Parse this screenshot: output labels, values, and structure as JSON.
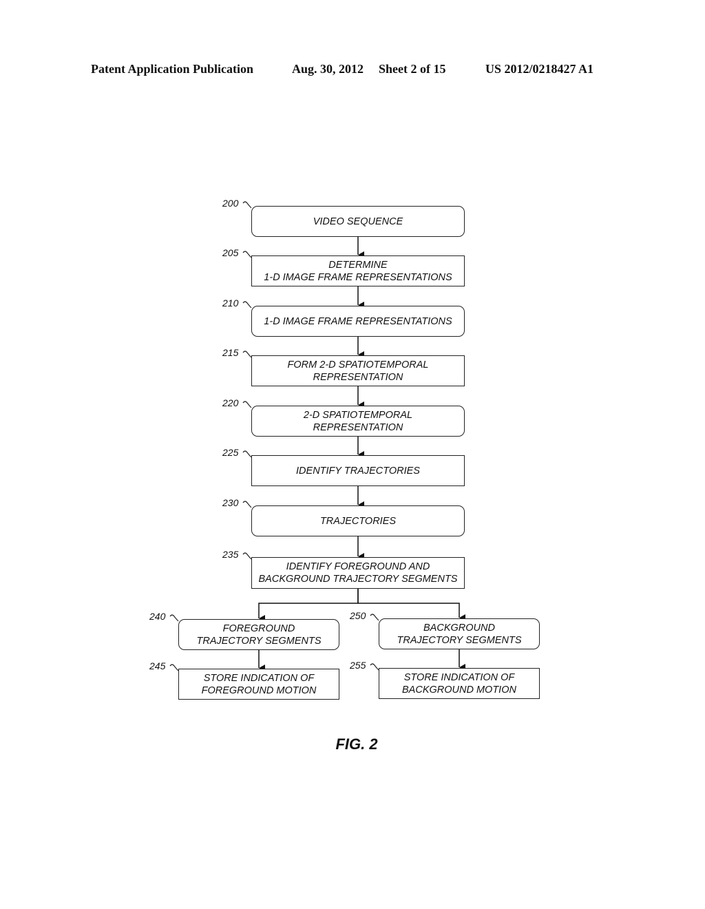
{
  "header": {
    "publication": "Patent Application Publication",
    "date": "Aug. 30, 2012",
    "sheet": "Sheet 2 of 15",
    "number": "US 2012/0218427 A1"
  },
  "nodes": [
    {
      "ref": "200",
      "shape": "rounded",
      "lines": [
        "VIDEO SEQUENCE"
      ]
    },
    {
      "ref": "205",
      "shape": "rect",
      "lines": [
        "DETERMINE",
        "1-D IMAGE FRAME REPRESENTATIONS"
      ]
    },
    {
      "ref": "210",
      "shape": "rounded",
      "lines": [
        "1-D IMAGE FRAME REPRESENTATIONS"
      ]
    },
    {
      "ref": "215",
      "shape": "rect",
      "lines": [
        "FORM 2-D SPATIOTEMPORAL",
        "REPRESENTATION"
      ]
    },
    {
      "ref": "220",
      "shape": "rounded",
      "lines": [
        "2-D SPATIOTEMPORAL",
        "REPRESENTATION"
      ]
    },
    {
      "ref": "225",
      "shape": "rect",
      "lines": [
        "IDENTIFY TRAJECTORIES"
      ]
    },
    {
      "ref": "230",
      "shape": "rounded",
      "lines": [
        "TRAJECTORIES"
      ]
    },
    {
      "ref": "235",
      "shape": "rect",
      "lines": [
        "IDENTIFY FOREGROUND AND",
        "BACKGROUND TRAJECTORY SEGMENTS"
      ]
    },
    {
      "ref": "240",
      "shape": "rounded",
      "lines": [
        "FOREGROUND",
        "TRAJECTORY SEGMENTS"
      ]
    },
    {
      "ref": "245",
      "shape": "rect",
      "lines": [
        "STORE INDICATION OF",
        "FOREGROUND MOTION"
      ]
    },
    {
      "ref": "250",
      "shape": "rounded",
      "lines": [
        "BACKGROUND",
        "TRAJECTORY SEGMENTS"
      ]
    },
    {
      "ref": "255",
      "shape": "rect",
      "lines": [
        "STORE INDICATION OF",
        "BACKGROUND MOTION"
      ]
    }
  ],
  "edges": [
    [
      "200",
      "205"
    ],
    [
      "205",
      "210"
    ],
    [
      "210",
      "215"
    ],
    [
      "215",
      "220"
    ],
    [
      "220",
      "225"
    ],
    [
      "225",
      "230"
    ],
    [
      "230",
      "235"
    ],
    [
      "235",
      "240"
    ],
    [
      "235",
      "250"
    ],
    [
      "240",
      "245"
    ],
    [
      "250",
      "255"
    ]
  ],
  "figure_label": "FIG. 2"
}
